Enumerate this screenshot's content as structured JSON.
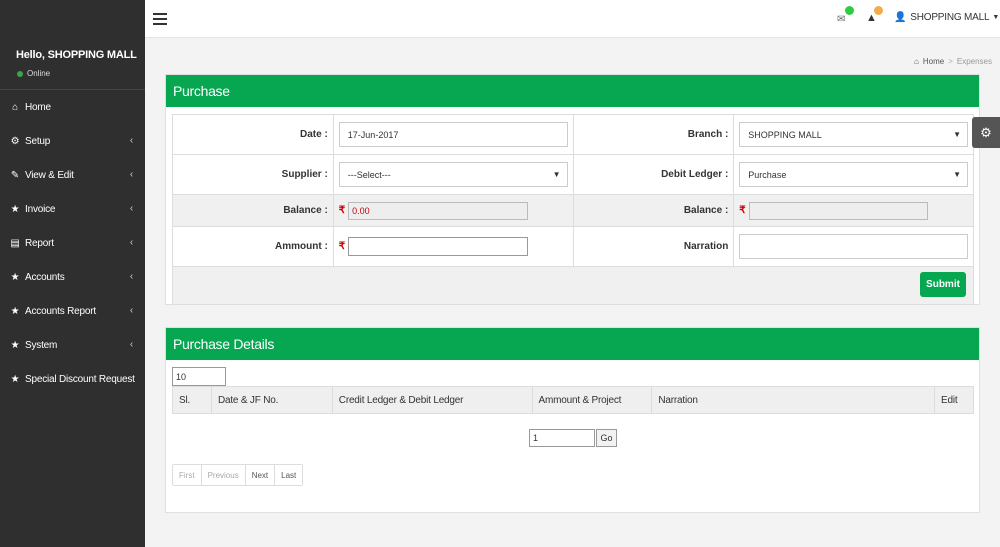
{
  "sidebar": {
    "greeting": "Hello, SHOPPING MALL",
    "status": "Online",
    "items": [
      {
        "label": "Home",
        "icon": "home-icon",
        "glyph": "⌂",
        "has_children": false
      },
      {
        "label": "Setup",
        "icon": "cogs-icon",
        "glyph": "⚙",
        "has_children": true
      },
      {
        "label": "View & Edit",
        "icon": "edit-icon",
        "glyph": "✎",
        "has_children": true
      },
      {
        "label": "Invoice",
        "icon": "star-icon",
        "glyph": "★",
        "has_children": true
      },
      {
        "label": "Report",
        "icon": "file-icon",
        "glyph": "▤",
        "has_children": true
      },
      {
        "label": "Accounts",
        "icon": "star-icon",
        "glyph": "★",
        "has_children": true
      },
      {
        "label": "Accounts Report",
        "icon": "star-icon",
        "glyph": "★",
        "has_children": true
      },
      {
        "label": "System",
        "icon": "star-icon",
        "glyph": "★",
        "has_children": true
      },
      {
        "label": "Special Discount Request",
        "icon": "star-icon",
        "glyph": "★",
        "has_children": false
      }
    ]
  },
  "topbar": {
    "user_name": "SHOPPING MALL",
    "notification_colors": {
      "mail": "#2ecc40",
      "alert": "#f0ad4e"
    }
  },
  "breadcrumb": {
    "home": "Home",
    "current": "Expenses"
  },
  "purchase": {
    "title": "Purchase",
    "date_label": "Date :",
    "date_value": "17-Jun-2017",
    "branch_label": "Branch :",
    "branch_value": "SHOPPING MALL",
    "supplier_label": "Supplier :",
    "supplier_value": "---Select---",
    "debit_ledger_label": "Debit Ledger :",
    "debit_ledger_value": "Purchase",
    "balance_label": "Balance :",
    "balance_value": "0.00",
    "balance2_label": "Balance :",
    "balance2_value": "",
    "amount_label": "Ammount :",
    "narration_label": "Narration",
    "submit_label": "Submit",
    "currency_symbol": "₹"
  },
  "details": {
    "title": "Purchase Details",
    "page_size": "10",
    "columns": [
      "Sl.",
      "Date & JF No.",
      "Credit Ledger & Debit Ledger",
      "Ammount & Project",
      "Narration",
      "Edit"
    ],
    "page_number": "1",
    "go_label": "Go",
    "pager": [
      "First",
      "Previous",
      "Next",
      "Last"
    ]
  },
  "colors": {
    "accent": "#07a650",
    "sidebar": "#2f2f2f"
  }
}
